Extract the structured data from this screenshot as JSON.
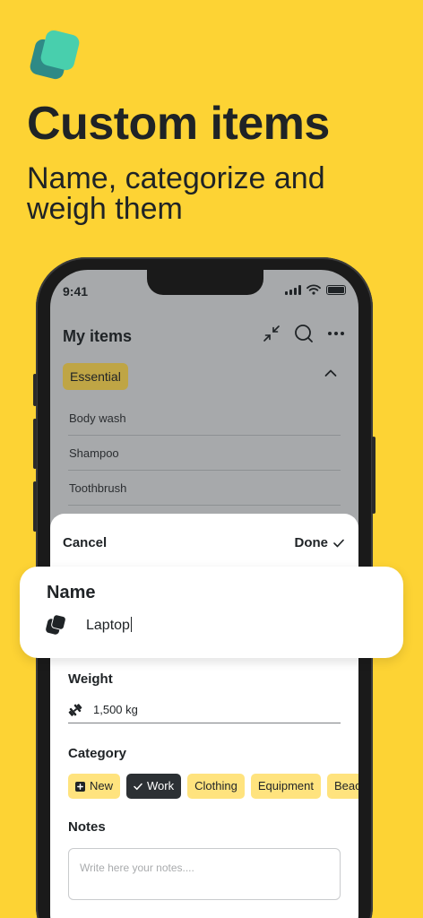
{
  "promo": {
    "headline": "Custom items",
    "subhead": "Name, categorize and weigh them"
  },
  "status_bar": {
    "time": "9:41"
  },
  "app": {
    "title": "My items",
    "category_pill": "Essential",
    "background_items": [
      "Body wash",
      "Shampoo",
      "Toothbrush"
    ]
  },
  "sheet": {
    "cancel_label": "Cancel",
    "done_label": "Done",
    "name_label": "Name",
    "name_value": "Laptop",
    "weight_label": "Weight",
    "weight_value": "1,500 kg",
    "category_label": "Category",
    "categories": [
      {
        "label": "New",
        "selected": false,
        "icon": "plus-square-icon"
      },
      {
        "label": "Work",
        "selected": true,
        "icon": "check-icon"
      },
      {
        "label": "Clothing",
        "selected": false
      },
      {
        "label": "Equipment",
        "selected": false
      },
      {
        "label": "Beach",
        "selected": false
      }
    ],
    "notes_label": "Notes",
    "notes_placeholder": "Write here your notes...."
  },
  "colors": {
    "background": "#FDD334",
    "chip": "#FFE37E",
    "chip_selected": "#2C3034",
    "logo_back": "#2F8A86",
    "logo_front": "#48CFAD",
    "essential_pill": "#BFA545"
  }
}
